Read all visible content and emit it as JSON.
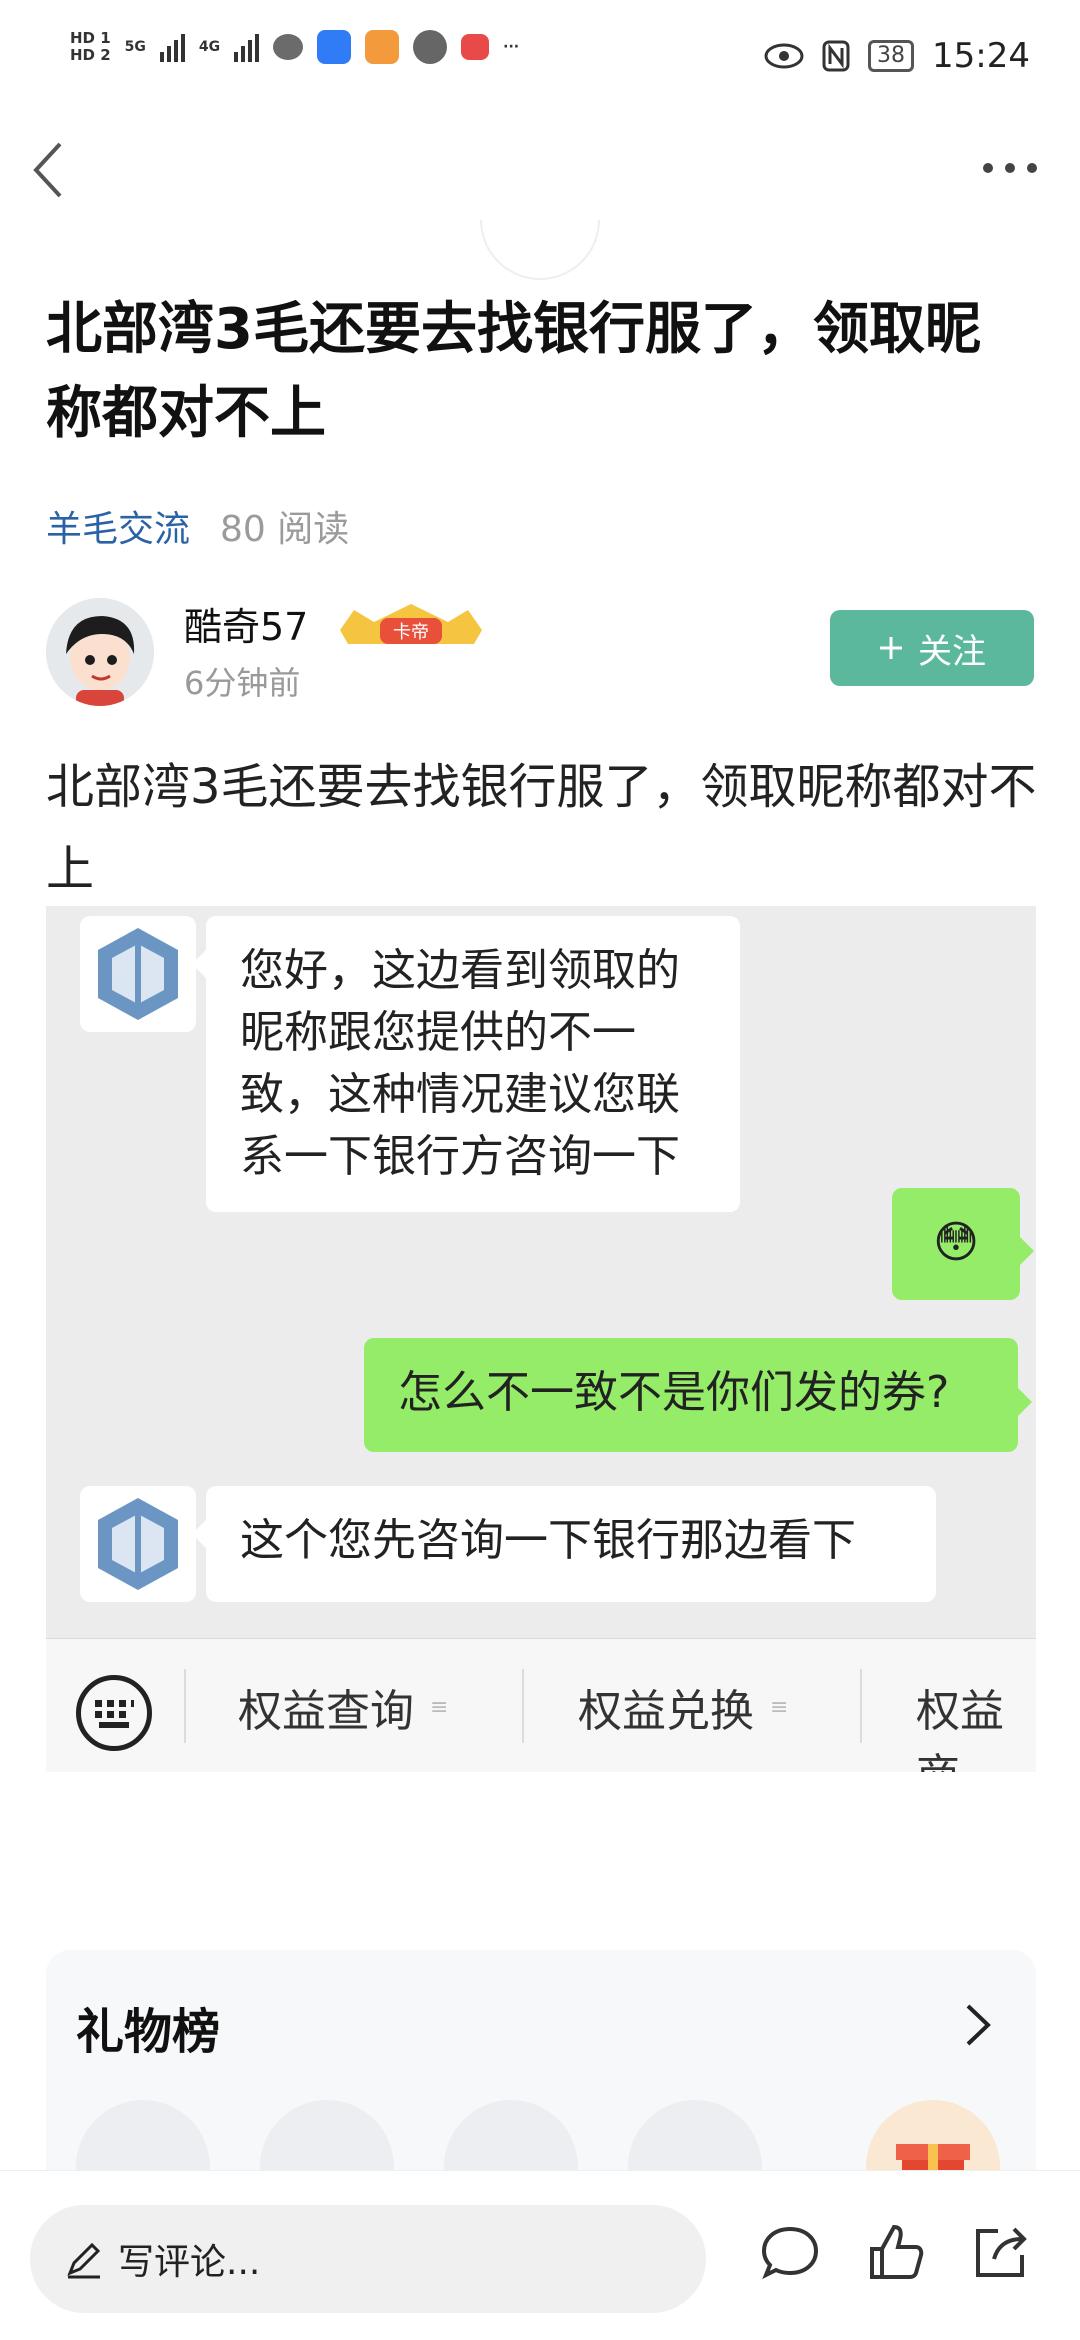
{
  "status_bar": {
    "hd1": "HD 1",
    "hd2": "HD 2",
    "sig5g": "5G",
    "sig4g": "4G",
    "more": "···",
    "battery": "38",
    "time": "15:24"
  },
  "post": {
    "title": "北部湾3毛还要去找银行服了，领取昵称都对不上",
    "category": "羊毛交流",
    "reads": "80 阅读",
    "author": "酷奇57",
    "badge": "卡帝",
    "time": "6分钟前",
    "follow": "关注",
    "body": "北部湾3毛还要去找银行服了，领取昵称都对不上"
  },
  "chat_screenshot": {
    "messages": [
      {
        "from": "bot",
        "text": "您好，这边看到领取的昵称跟您提供的不一致，这种情况建议您联系一下银行方咨询一下"
      },
      {
        "from": "me",
        "text": "😳"
      },
      {
        "from": "me",
        "text": "怎么不一致不是你们发的券?"
      },
      {
        "from": "bot",
        "text": "这个您先咨询一下银行那边看下"
      }
    ],
    "tabs": [
      "权益查询",
      "权益兑换",
      "权益商"
    ]
  },
  "gift": {
    "title": "礼物榜"
  },
  "bottom_bar": {
    "comment_placeholder": "写评论..."
  },
  "colors": {
    "accent_green": "#5bb89c",
    "link_blue": "#2a62a6",
    "chat_green": "#95ec69"
  }
}
